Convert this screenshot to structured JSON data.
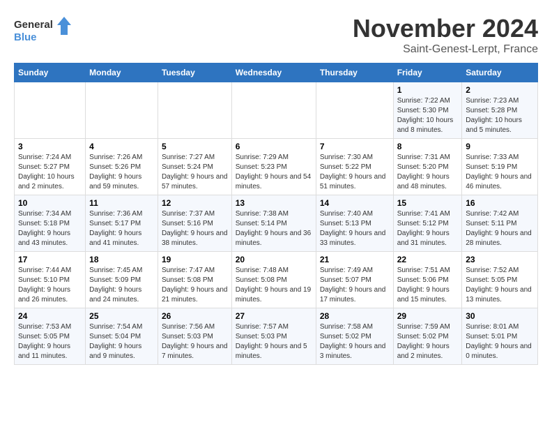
{
  "logo": {
    "line1": "General",
    "line2": "Blue"
  },
  "title": "November 2024",
  "subtitle": "Saint-Genest-Lerpt, France",
  "weekdays": [
    "Sunday",
    "Monday",
    "Tuesday",
    "Wednesday",
    "Thursday",
    "Friday",
    "Saturday"
  ],
  "weeks": [
    [
      {
        "day": "",
        "info": ""
      },
      {
        "day": "",
        "info": ""
      },
      {
        "day": "",
        "info": ""
      },
      {
        "day": "",
        "info": ""
      },
      {
        "day": "",
        "info": ""
      },
      {
        "day": "1",
        "info": "Sunrise: 7:22 AM\nSunset: 5:30 PM\nDaylight: 10 hours\nand 8 minutes."
      },
      {
        "day": "2",
        "info": "Sunrise: 7:23 AM\nSunset: 5:28 PM\nDaylight: 10 hours\nand 5 minutes."
      }
    ],
    [
      {
        "day": "3",
        "info": "Sunrise: 7:24 AM\nSunset: 5:27 PM\nDaylight: 10 hours\nand 2 minutes."
      },
      {
        "day": "4",
        "info": "Sunrise: 7:26 AM\nSunset: 5:26 PM\nDaylight: 9 hours\nand 59 minutes."
      },
      {
        "day": "5",
        "info": "Sunrise: 7:27 AM\nSunset: 5:24 PM\nDaylight: 9 hours\nand 57 minutes."
      },
      {
        "day": "6",
        "info": "Sunrise: 7:29 AM\nSunset: 5:23 PM\nDaylight: 9 hours\nand 54 minutes."
      },
      {
        "day": "7",
        "info": "Sunrise: 7:30 AM\nSunset: 5:22 PM\nDaylight: 9 hours\nand 51 minutes."
      },
      {
        "day": "8",
        "info": "Sunrise: 7:31 AM\nSunset: 5:20 PM\nDaylight: 9 hours\nand 48 minutes."
      },
      {
        "day": "9",
        "info": "Sunrise: 7:33 AM\nSunset: 5:19 PM\nDaylight: 9 hours\nand 46 minutes."
      }
    ],
    [
      {
        "day": "10",
        "info": "Sunrise: 7:34 AM\nSunset: 5:18 PM\nDaylight: 9 hours\nand 43 minutes."
      },
      {
        "day": "11",
        "info": "Sunrise: 7:36 AM\nSunset: 5:17 PM\nDaylight: 9 hours\nand 41 minutes."
      },
      {
        "day": "12",
        "info": "Sunrise: 7:37 AM\nSunset: 5:16 PM\nDaylight: 9 hours\nand 38 minutes."
      },
      {
        "day": "13",
        "info": "Sunrise: 7:38 AM\nSunset: 5:14 PM\nDaylight: 9 hours\nand 36 minutes."
      },
      {
        "day": "14",
        "info": "Sunrise: 7:40 AM\nSunset: 5:13 PM\nDaylight: 9 hours\nand 33 minutes."
      },
      {
        "day": "15",
        "info": "Sunrise: 7:41 AM\nSunset: 5:12 PM\nDaylight: 9 hours\nand 31 minutes."
      },
      {
        "day": "16",
        "info": "Sunrise: 7:42 AM\nSunset: 5:11 PM\nDaylight: 9 hours\nand 28 minutes."
      }
    ],
    [
      {
        "day": "17",
        "info": "Sunrise: 7:44 AM\nSunset: 5:10 PM\nDaylight: 9 hours\nand 26 minutes."
      },
      {
        "day": "18",
        "info": "Sunrise: 7:45 AM\nSunset: 5:09 PM\nDaylight: 9 hours\nand 24 minutes."
      },
      {
        "day": "19",
        "info": "Sunrise: 7:47 AM\nSunset: 5:08 PM\nDaylight: 9 hours\nand 21 minutes."
      },
      {
        "day": "20",
        "info": "Sunrise: 7:48 AM\nSunset: 5:08 PM\nDaylight: 9 hours\nand 19 minutes."
      },
      {
        "day": "21",
        "info": "Sunrise: 7:49 AM\nSunset: 5:07 PM\nDaylight: 9 hours\nand 17 minutes."
      },
      {
        "day": "22",
        "info": "Sunrise: 7:51 AM\nSunset: 5:06 PM\nDaylight: 9 hours\nand 15 minutes."
      },
      {
        "day": "23",
        "info": "Sunrise: 7:52 AM\nSunset: 5:05 PM\nDaylight: 9 hours\nand 13 minutes."
      }
    ],
    [
      {
        "day": "24",
        "info": "Sunrise: 7:53 AM\nSunset: 5:05 PM\nDaylight: 9 hours\nand 11 minutes."
      },
      {
        "day": "25",
        "info": "Sunrise: 7:54 AM\nSunset: 5:04 PM\nDaylight: 9 hours\nand 9 minutes."
      },
      {
        "day": "26",
        "info": "Sunrise: 7:56 AM\nSunset: 5:03 PM\nDaylight: 9 hours\nand 7 minutes."
      },
      {
        "day": "27",
        "info": "Sunrise: 7:57 AM\nSunset: 5:03 PM\nDaylight: 9 hours\nand 5 minutes."
      },
      {
        "day": "28",
        "info": "Sunrise: 7:58 AM\nSunset: 5:02 PM\nDaylight: 9 hours\nand 3 minutes."
      },
      {
        "day": "29",
        "info": "Sunrise: 7:59 AM\nSunset: 5:02 PM\nDaylight: 9 hours\nand 2 minutes."
      },
      {
        "day": "30",
        "info": "Sunrise: 8:01 AM\nSunset: 5:01 PM\nDaylight: 9 hours\nand 0 minutes."
      }
    ]
  ]
}
